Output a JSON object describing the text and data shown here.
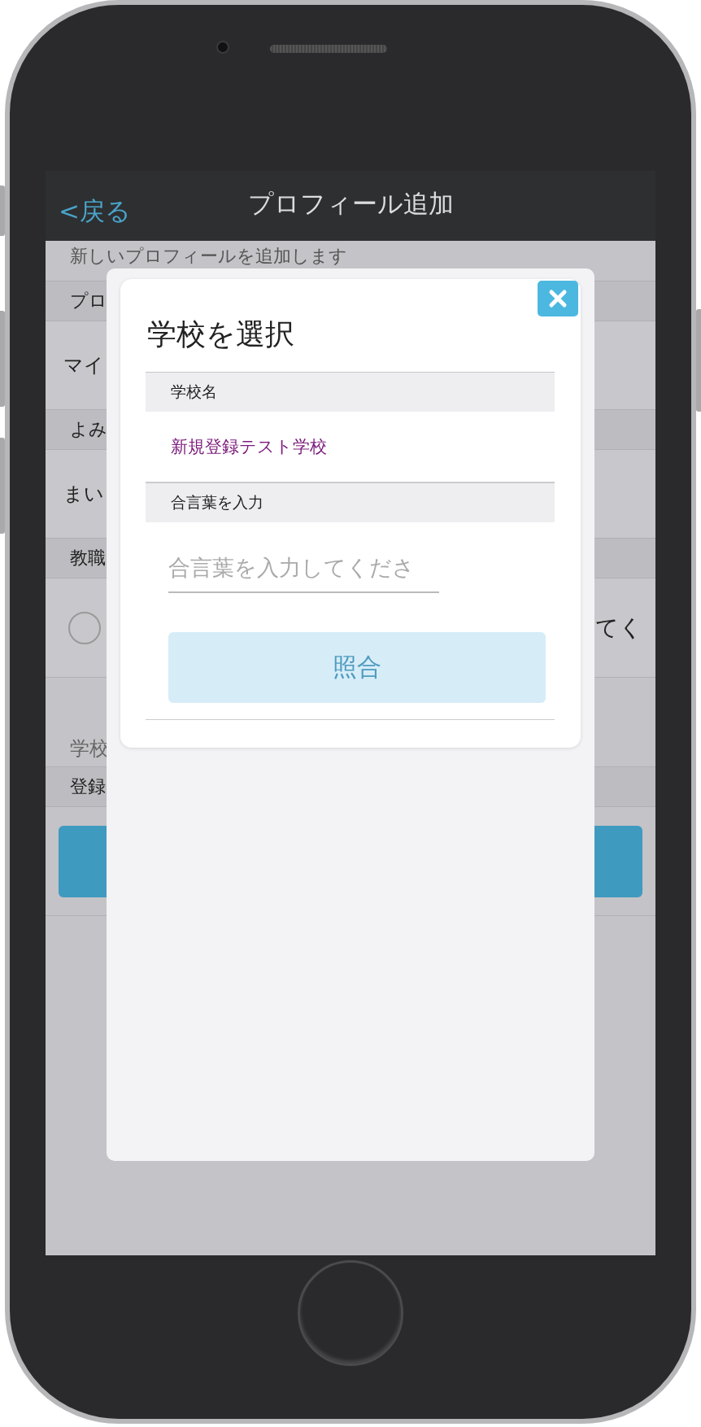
{
  "nav": {
    "back": "<戻る",
    "title": "プロフィール追加"
  },
  "background": {
    "rows": [
      {
        "kind": "note",
        "text": "新しいプロフィールを追加します"
      },
      {
        "kind": "header",
        "text": "プロ"
      },
      {
        "kind": "field",
        "text": "マイ"
      },
      {
        "kind": "header",
        "text": "よみ"
      },
      {
        "kind": "field",
        "text": "まい"
      },
      {
        "kind": "header",
        "text": "教職"
      },
      {
        "kind": "radio",
        "checked": false,
        "text": "てく"
      },
      {
        "kind": "note2",
        "text": "学校"
      },
      {
        "kind": "header",
        "text": "登録"
      },
      {
        "kind": "button"
      }
    ]
  },
  "dialog": {
    "title": "学校を選択",
    "sections": [
      {
        "kind": "value",
        "header": "学校名",
        "value": "新規登録テスト学校"
      },
      {
        "kind": "input",
        "header": "合言葉を入力",
        "placeholder": "合言葉を入力してくださ"
      }
    ],
    "button": {
      "label": "照合",
      "disabled": true
    }
  }
}
